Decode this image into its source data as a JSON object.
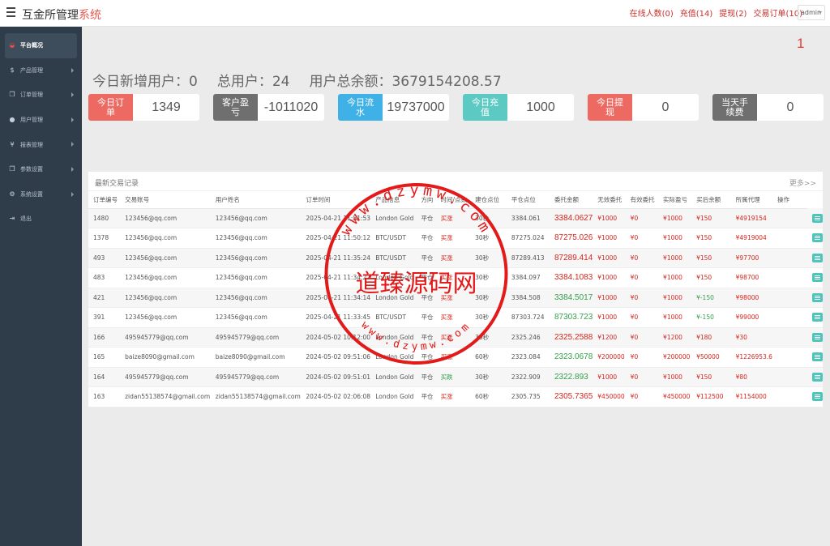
{
  "brand": {
    "title_main": "互金所管理",
    "title_accent": "系统"
  },
  "top_links": [
    "在线人数(0)",
    "充值(14)",
    "提现(2)",
    "交易订单(10)"
  ],
  "admin": {
    "label": "admin"
  },
  "sidebar": {
    "items": [
      {
        "label": "平台概况",
        "icon": "dashboard-icon",
        "active": true
      },
      {
        "label": "产品管理",
        "icon": "dollar-icon"
      },
      {
        "label": "订单管理",
        "icon": "copy-icon"
      },
      {
        "label": "用户管理",
        "icon": "user-icon"
      },
      {
        "label": "报表管理",
        "icon": "yen-icon"
      },
      {
        "label": "参数设置",
        "icon": "copy-icon"
      },
      {
        "label": "系统设置",
        "icon": "cogs-icon"
      },
      {
        "label": "退出",
        "icon": "signout-icon"
      }
    ]
  },
  "page_number": "1",
  "stats": {
    "new_users": "今日新增用户：0",
    "total_users": "总用户：24",
    "total_balance": "用户总余额：3679154208.57"
  },
  "cards": [
    {
      "label": "今日订单",
      "value": "1349",
      "color": "#ec6a62"
    },
    {
      "label": "客户盈亏",
      "value": "-1011020",
      "color": "#6f6f6f"
    },
    {
      "label": "今日流水",
      "value": "19737000",
      "color": "#3fb1e6"
    },
    {
      "label": "今日充值",
      "value": "1000",
      "color": "#5ccac2"
    },
    {
      "label": "今日提现",
      "value": "0",
      "color": "#ec6a62"
    },
    {
      "label": "当天手续费",
      "value": "0",
      "color": "#6f6f6f"
    }
  ],
  "panel": {
    "title": "最新交易记录",
    "more": "更多>>"
  },
  "table": {
    "headers": [
      "订单编号",
      "交易账号",
      "用户姓名",
      "订单时间",
      "产品信息",
      "方向",
      "时间/点数",
      "建仓点位",
      "平仓点位",
      "委托金额",
      "无效委托",
      "有效委托",
      "实际盈亏",
      "买后余额",
      "所属代理",
      "操作"
    ],
    "rows": [
      [
        "1480",
        "123456@qq.com",
        "123456@qq.com",
        "2025-04-21 11:51:53",
        "London Gold",
        "平仓",
        "买涨",
        "30秒",
        "3384.061",
        "3384.0627",
        "¥1000",
        "¥0",
        "¥1000",
        "¥150",
        "¥4919154",
        ""
      ],
      [
        "1378",
        "123456@qq.com",
        "123456@qq.com",
        "2025-04-21 11:50:12",
        "BTC/USDT",
        "平仓",
        "买涨",
        "30秒",
        "87275.024",
        "87275.026",
        "¥1000",
        "¥0",
        "¥1000",
        "¥150",
        "¥4919004",
        ""
      ],
      [
        "493",
        "123456@qq.com",
        "123456@qq.com",
        "2025-04-21 11:35:24",
        "BTC/USDT",
        "平仓",
        "买涨",
        "30秒",
        "87289.413",
        "87289.414",
        "¥1000",
        "¥0",
        "¥1000",
        "¥150",
        "¥97700",
        ""
      ],
      [
        "483",
        "123456@qq.com",
        "123456@qq.com",
        "2025-04-21 11:34:27",
        "London Gold",
        "平仓",
        "买涨",
        "30秒",
        "3384.097",
        "3384.1083",
        "¥1000",
        "¥0",
        "¥1000",
        "¥150",
        "¥98700",
        ""
      ],
      [
        "421",
        "123456@qq.com",
        "123456@qq.com",
        "2025-04-21 11:34:14",
        "London Gold",
        "平仓",
        "买涨",
        "30秒",
        "3384.508",
        "3384.5017",
        "¥1000",
        "¥0",
        "¥1000",
        "¥-150",
        "¥98000",
        ""
      ],
      [
        "391",
        "123456@qq.com",
        "123456@qq.com",
        "2025-04-21 11:33:45",
        "BTC/USDT",
        "平仓",
        "买涨",
        "30秒",
        "87303.724",
        "87303.723",
        "¥1000",
        "¥0",
        "¥1000",
        "¥-150",
        "¥99000",
        ""
      ],
      [
        "166",
        "495945779@qq.com",
        "495945779@qq.com",
        "2024-05-02 10:12:00",
        "London Gold",
        "平仓",
        "买涨",
        "30秒",
        "2325.246",
        "2325.2588",
        "¥1200",
        "¥0",
        "¥1200",
        "¥180",
        "¥30",
        ""
      ],
      [
        "165",
        "baize8090@gmail.com",
        "baize8090@gmail.com",
        "2024-05-02 09:51:06",
        "London Gold",
        "平仓",
        "买涨",
        "60秒",
        "2323.084",
        "2323.0678",
        "¥200000",
        "¥0",
        "¥200000",
        "¥50000",
        "¥1226953.6",
        ""
      ],
      [
        "164",
        "495945779@qq.com",
        "495945779@qq.com",
        "2024-05-02 09:51:01",
        "London Gold",
        "平仓",
        "买跌",
        "30秒",
        "2322.909",
        "2322.893",
        "¥1000",
        "¥0",
        "¥1000",
        "¥150",
        "¥80",
        ""
      ],
      [
        "163",
        "zidan55138574@gmail.com",
        "zidan55138574@gmail.com",
        "2024-05-02 02:06:08",
        "London Gold",
        "平仓",
        "买涨",
        "60秒",
        "2305.735",
        "2305.7365",
        "¥450000",
        "¥0",
        "¥450000",
        "¥112500",
        "¥1154000",
        ""
      ]
    ],
    "close_colors": [
      "red",
      "red",
      "red",
      "red",
      "green",
      "green",
      "red",
      "green",
      "green",
      "red"
    ],
    "direction_colors": [
      "red",
      "red",
      "red",
      "red",
      "red",
      "red",
      "red",
      "red",
      "green",
      "red"
    ],
    "pnl_colors": [
      "red",
      "red",
      "red",
      "red",
      "green",
      "green",
      "red",
      "red",
      "red",
      "red"
    ]
  },
  "watermark": {
    "text": "道臻源码网",
    "url_top": "www.dzymw.com",
    "url_bottom": "www.dzymw.com",
    "color": "#e21a1a"
  }
}
